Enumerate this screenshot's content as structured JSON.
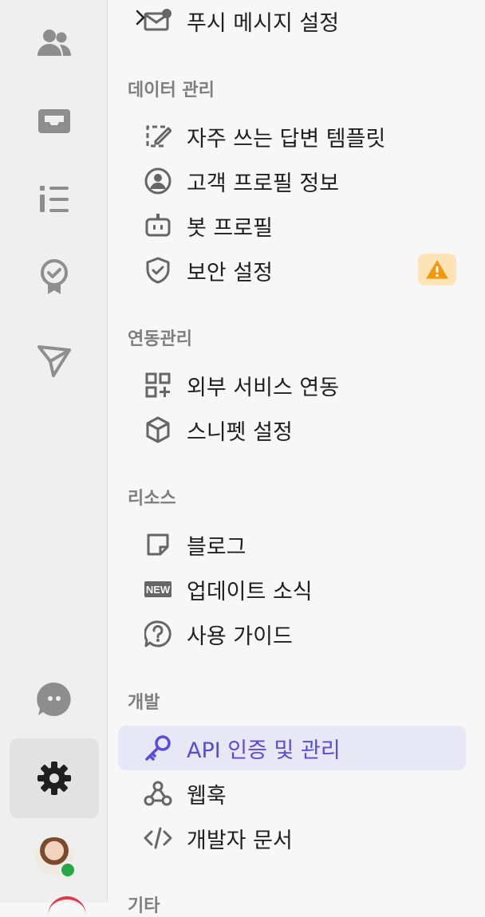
{
  "colors": {
    "accent": "#5b4bdb",
    "active_bg": "#e8e7f6",
    "warning": "#f5960b",
    "online": "#27a845"
  },
  "rail": {
    "items": [
      {
        "icon": "users-icon"
      },
      {
        "icon": "inbox-icon"
      },
      {
        "icon": "list-icon"
      },
      {
        "icon": "badge-icon"
      },
      {
        "icon": "send-icon"
      },
      {
        "icon": "chat-bubble-icon"
      },
      {
        "icon": "gear-icon",
        "active": true
      }
    ],
    "avatar_status": "online"
  },
  "menu": {
    "push_settings": "푸시 메시지 설정",
    "sections": {
      "data": "데이터 관리",
      "integration": "연동관리",
      "resources": "리소스",
      "dev": "개발",
      "etc": "기타"
    },
    "items": {
      "templates": "자주 쓰는 답변 템플릿",
      "customer_profile": "고객 프로필 정보",
      "bot_profile": "봇 프로필",
      "security": "보안 설정",
      "external_services": "외부 서비스 연동",
      "snippet": "스니펫 설정",
      "blog": "블로그",
      "updates": "업데이트 소식",
      "guide": "사용 가이드",
      "api": "API 인증 및 관리",
      "webhook": "웹훅",
      "dev_docs": "개발자 문서"
    },
    "security_warning": true
  }
}
